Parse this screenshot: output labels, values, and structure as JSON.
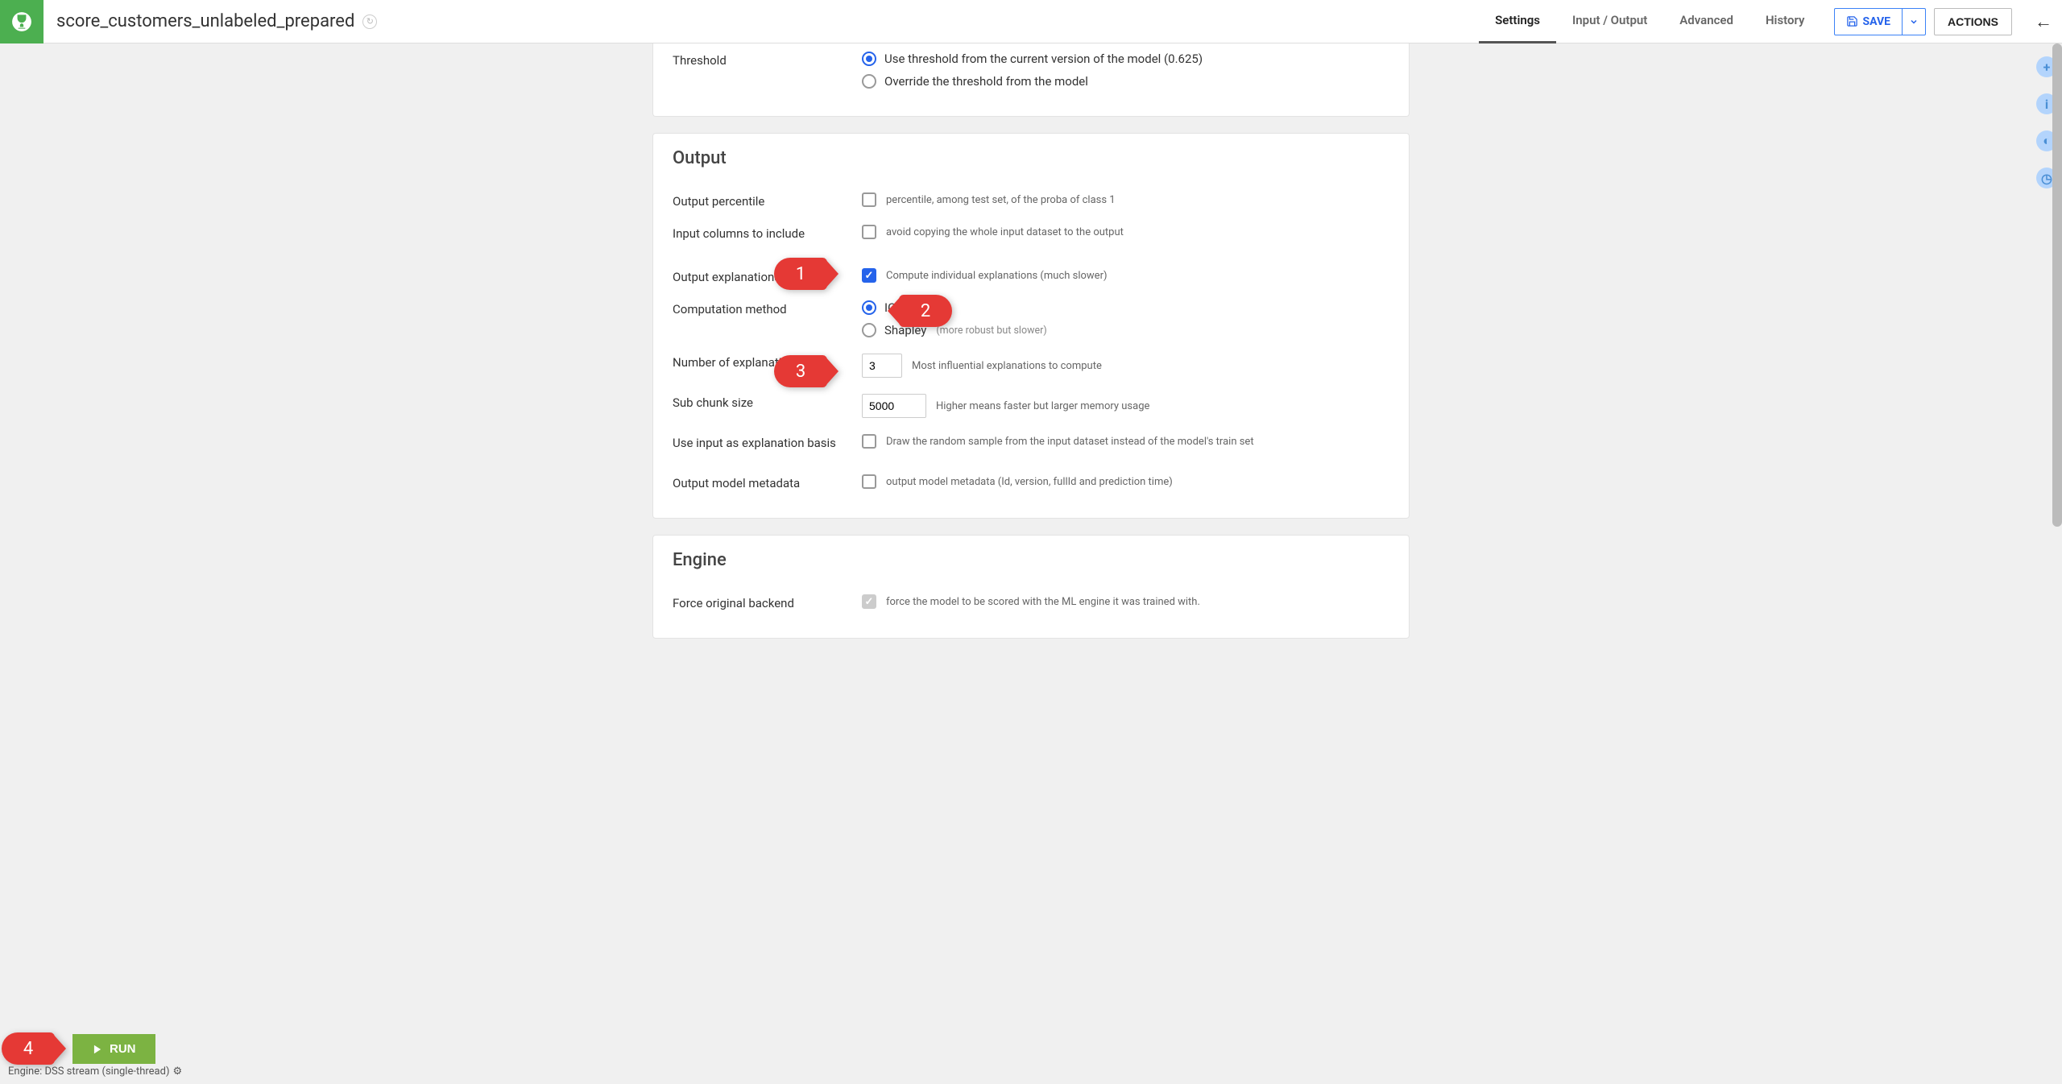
{
  "header": {
    "title": "score_customers_unlabeled_prepared",
    "tabs": [
      "Settings",
      "Input / Output",
      "Advanced",
      "History"
    ],
    "active_tab": "Settings",
    "save_label": "SAVE",
    "actions_label": "ACTIONS"
  },
  "threshold": {
    "label": "Threshold",
    "opt_use": "Use threshold from the current version of the model (0.625)",
    "opt_override": "Override the threshold from the model"
  },
  "output": {
    "title": "Output",
    "percentile": {
      "label": "Output percentile",
      "help": "percentile, among test set, of the proba of class 1"
    },
    "input_cols": {
      "label": "Input columns to include",
      "help": "avoid copying the whole input dataset to the output"
    },
    "explanations": {
      "label": "Output explanations",
      "help": "Compute individual explanations (much slower)"
    },
    "computation": {
      "label": "Computation method",
      "ice": "ICE",
      "shapley": "Shapley",
      "shapley_help": "(more robust but slower)"
    },
    "num_expl": {
      "label": "Number of explanations",
      "value": "3",
      "help": "Most influential explanations to compute"
    },
    "sub_chunk": {
      "label": "Sub chunk size",
      "value": "5000",
      "help": "Higher means faster but larger memory usage"
    },
    "use_input": {
      "label": "Use input as explanation basis",
      "help": "Draw the random sample from the input dataset instead of the model's train set"
    },
    "metadata": {
      "label": "Output model metadata",
      "help": "output model metadata (Id, version, fullId and prediction time)"
    }
  },
  "engine": {
    "title": "Engine",
    "force_backend": {
      "label": "Force original backend",
      "help": "force the model to be scored with the ML engine it was trained with."
    }
  },
  "run": {
    "label": "RUN",
    "engine_text": "Engine: DSS stream (single-thread)"
  },
  "annotations": {
    "a1": "1",
    "a2": "2",
    "a3": "3",
    "a4": "4"
  }
}
